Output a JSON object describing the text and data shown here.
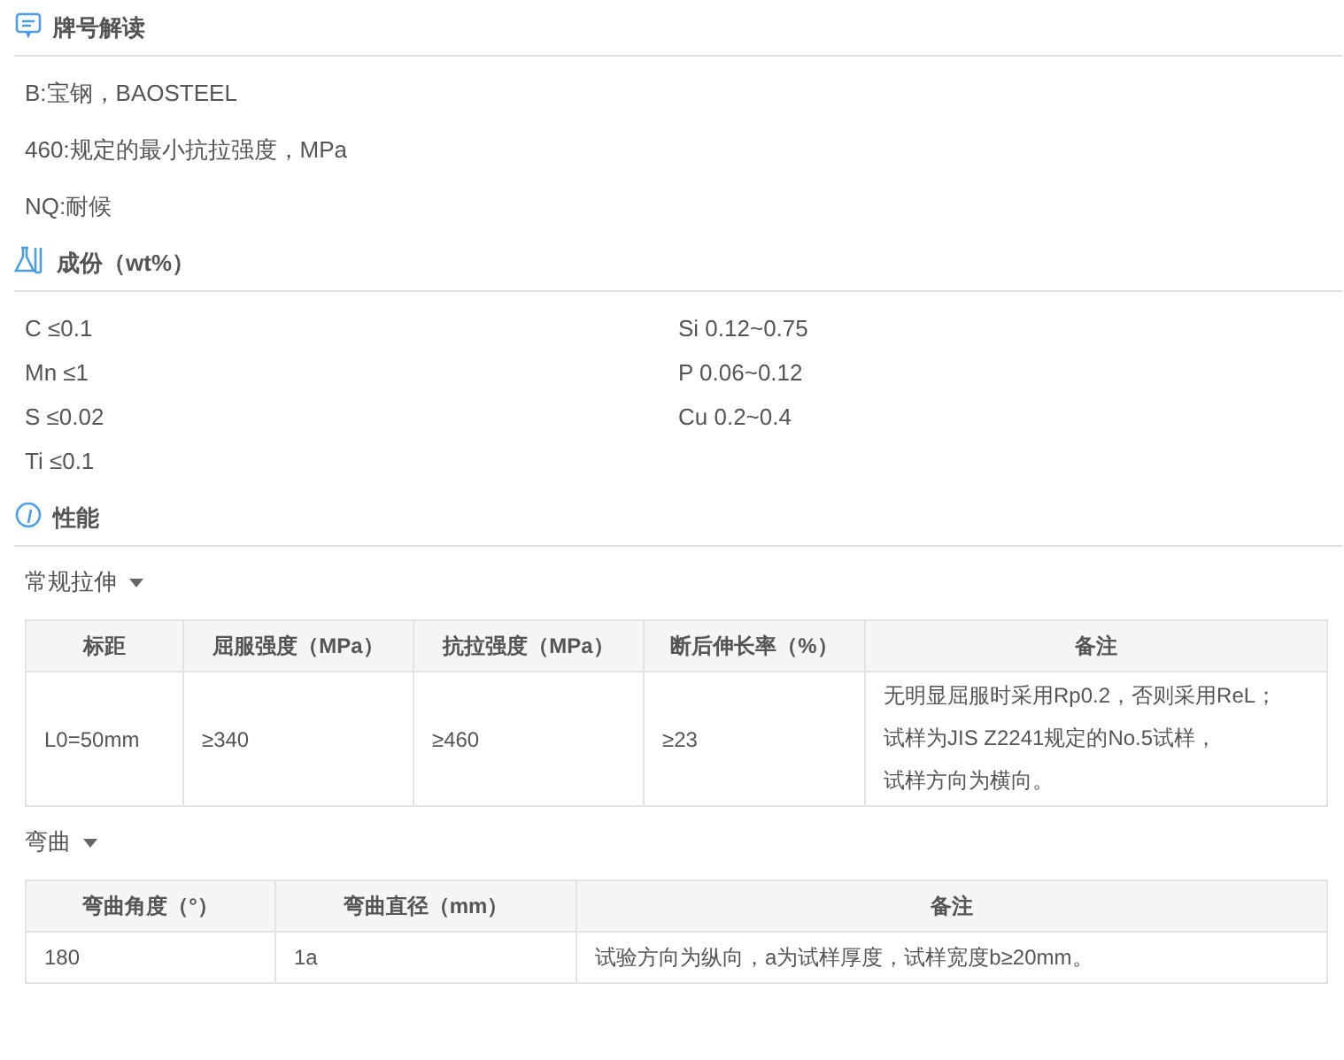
{
  "designation": {
    "title": "牌号解读",
    "lines": [
      "B:宝钢，BAOSTEEL",
      "460:规定的最小抗拉强度，MPa",
      "NQ:耐候"
    ]
  },
  "composition": {
    "title": "成份（wt%）",
    "left": [
      "C ≤0.1",
      "Mn ≤1",
      "S ≤0.02",
      "Ti ≤0.1"
    ],
    "right": [
      "Si 0.12~0.75",
      "P 0.06~0.12",
      "Cu 0.2~0.4"
    ]
  },
  "properties": {
    "title": "性能",
    "tables": [
      {
        "title": "常规拉伸",
        "expanded": true,
        "columns": [
          "标距",
          "屈服强度（MPa）",
          "抗拉强度（MPa）",
          "断后伸长率（%）",
          "备注"
        ],
        "rows": [
          {
            "cells": [
              "L0=50mm",
              "≥340",
              "≥460",
              "≥23"
            ],
            "remarks": [
              "无明显屈服时采用Rp0.2，否则采用ReL；",
              "试样为JIS Z2241规定的No.5试样，",
              "试样方向为横向。"
            ]
          }
        ]
      },
      {
        "title": "弯曲",
        "expanded": true,
        "columns": [
          "弯曲角度（°）",
          "弯曲直径（mm）",
          "备注"
        ],
        "rows": [
          {
            "cells": [
              "180",
              "1a"
            ],
            "remarks": [
              "试验方向为纵向，a为试样厚度，试样宽度b≥20mm。"
            ]
          }
        ]
      }
    ]
  }
}
